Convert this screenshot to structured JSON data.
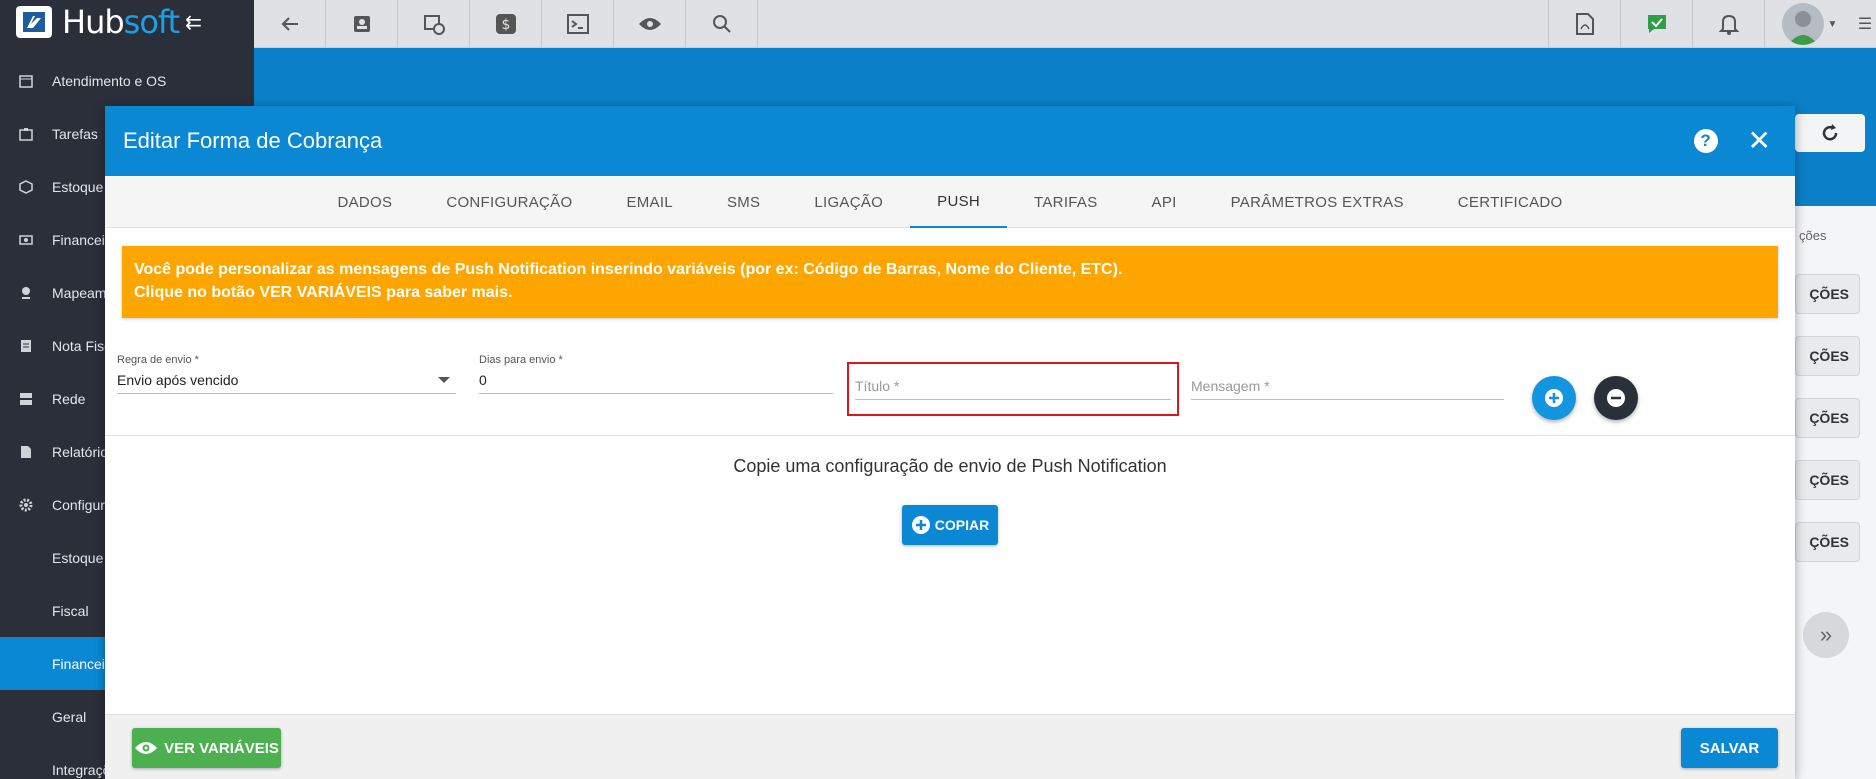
{
  "brand": {
    "name_part1": "Hub",
    "name_part2": "soft"
  },
  "sidebar": {
    "items": [
      {
        "label": "Atendimento e OS",
        "icon": "calendar-clock-icon"
      },
      {
        "label": "Tarefas",
        "icon": "tasks-icon"
      },
      {
        "label": "Estoque",
        "icon": "box-icon"
      },
      {
        "label": "Financeiro",
        "icon": "money-icon"
      },
      {
        "label": "Mapeamento",
        "icon": "map-marker-icon"
      },
      {
        "label": "Nota Fiscal",
        "icon": "document-icon"
      },
      {
        "label": "Rede",
        "icon": "server-icon"
      },
      {
        "label": "Relatórios",
        "icon": "report-icon"
      },
      {
        "label": "Configurações",
        "icon": "gear-icon"
      }
    ],
    "subitems": [
      {
        "label": "Estoque"
      },
      {
        "label": "Fiscal"
      },
      {
        "label": "Financeiro",
        "active": true
      },
      {
        "label": "Geral"
      },
      {
        "label": "Integrações"
      }
    ]
  },
  "background": {
    "column_header": "ções",
    "row_buttons": [
      "ÇÕES",
      "ÇÕES",
      "ÇÕES",
      "ÇÕES",
      "ÇÕES"
    ]
  },
  "modal": {
    "title": "Editar Forma de Cobrança",
    "tabs": [
      "DADOS",
      "CONFIGURAÇÃO",
      "EMAIL",
      "SMS",
      "LIGAÇÃO",
      "PUSH",
      "TARIFAS",
      "API",
      "PARÂMETROS EXTRAS",
      "CERTIFICADO"
    ],
    "active_tab": "PUSH",
    "alert": {
      "line1": "Você pode personalizar as mensagens de Push Notification inserindo variáveis (por ex: Código de Barras, Nome do Cliente, ETC).",
      "line2": "Clique no botão VER VARIÁVEIS para saber mais.",
      "color": "#ffa500"
    },
    "form": {
      "regra_label": "Regra de envio *",
      "regra_value": "Envio após vencido",
      "dias_label": "Dias para envio *",
      "dias_value": "0",
      "titulo_placeholder": "Título *",
      "mensagem_placeholder": "Mensagem *"
    },
    "copy_text": "Copie uma configuração de envio de Push Notification",
    "copy_button": "COPIAR",
    "footer": {
      "variables_button": "VER VARIÁVEIS",
      "save_button": "SALVAR"
    }
  },
  "colors": {
    "primary": "#0b88d3",
    "sidebar": "#2b2f3a",
    "success": "#4caf50",
    "error_border": "#e0141c"
  }
}
